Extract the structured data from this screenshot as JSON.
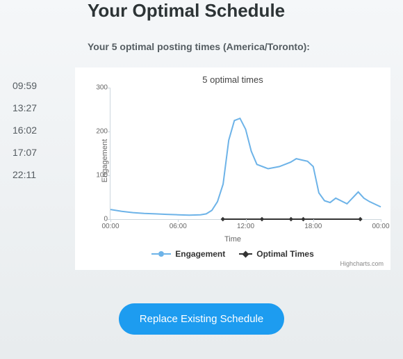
{
  "heading": "Your Optimal Schedule",
  "subheading": "Your 5 optimal posting times (America/Toronto):",
  "times": [
    "09:59",
    "13:27",
    "16:02",
    "17:07",
    "22:11"
  ],
  "credit": "Highcharts.com",
  "replace_label": "Replace Existing Schedule",
  "legend": {
    "engagement": "Engagement",
    "optimal": "Optimal Times"
  },
  "chart_data": {
    "type": "line",
    "title": "5 optimal times",
    "xlabel": "Time",
    "ylabel": "Engagement",
    "ylim": [
      0,
      300
    ],
    "xticks": [
      "00:00",
      "06:00",
      "12:00",
      "18:00",
      "00:00"
    ],
    "yticks": [
      0,
      100,
      200,
      300
    ],
    "series": [
      {
        "name": "Engagement",
        "x_hours": [
          0,
          1,
          2,
          3,
          4,
          5,
          6,
          7,
          8,
          8.5,
          9,
          9.5,
          10,
          10.5,
          11,
          11.5,
          12,
          12.5,
          13,
          14,
          15,
          16,
          16.5,
          17,
          17.5,
          18,
          18.5,
          19,
          19.5,
          20,
          21,
          22,
          22.5,
          23,
          24
        ],
        "values": [
          22,
          18,
          15,
          13,
          12,
          11,
          10,
          9,
          10,
          12,
          20,
          40,
          80,
          180,
          225,
          230,
          205,
          155,
          125,
          115,
          120,
          130,
          138,
          135,
          132,
          120,
          60,
          42,
          38,
          48,
          35,
          62,
          48,
          40,
          28
        ]
      }
    ],
    "optimal_times_hours": [
      9.98,
      13.45,
      16.03,
      17.12,
      22.18
    ]
  }
}
